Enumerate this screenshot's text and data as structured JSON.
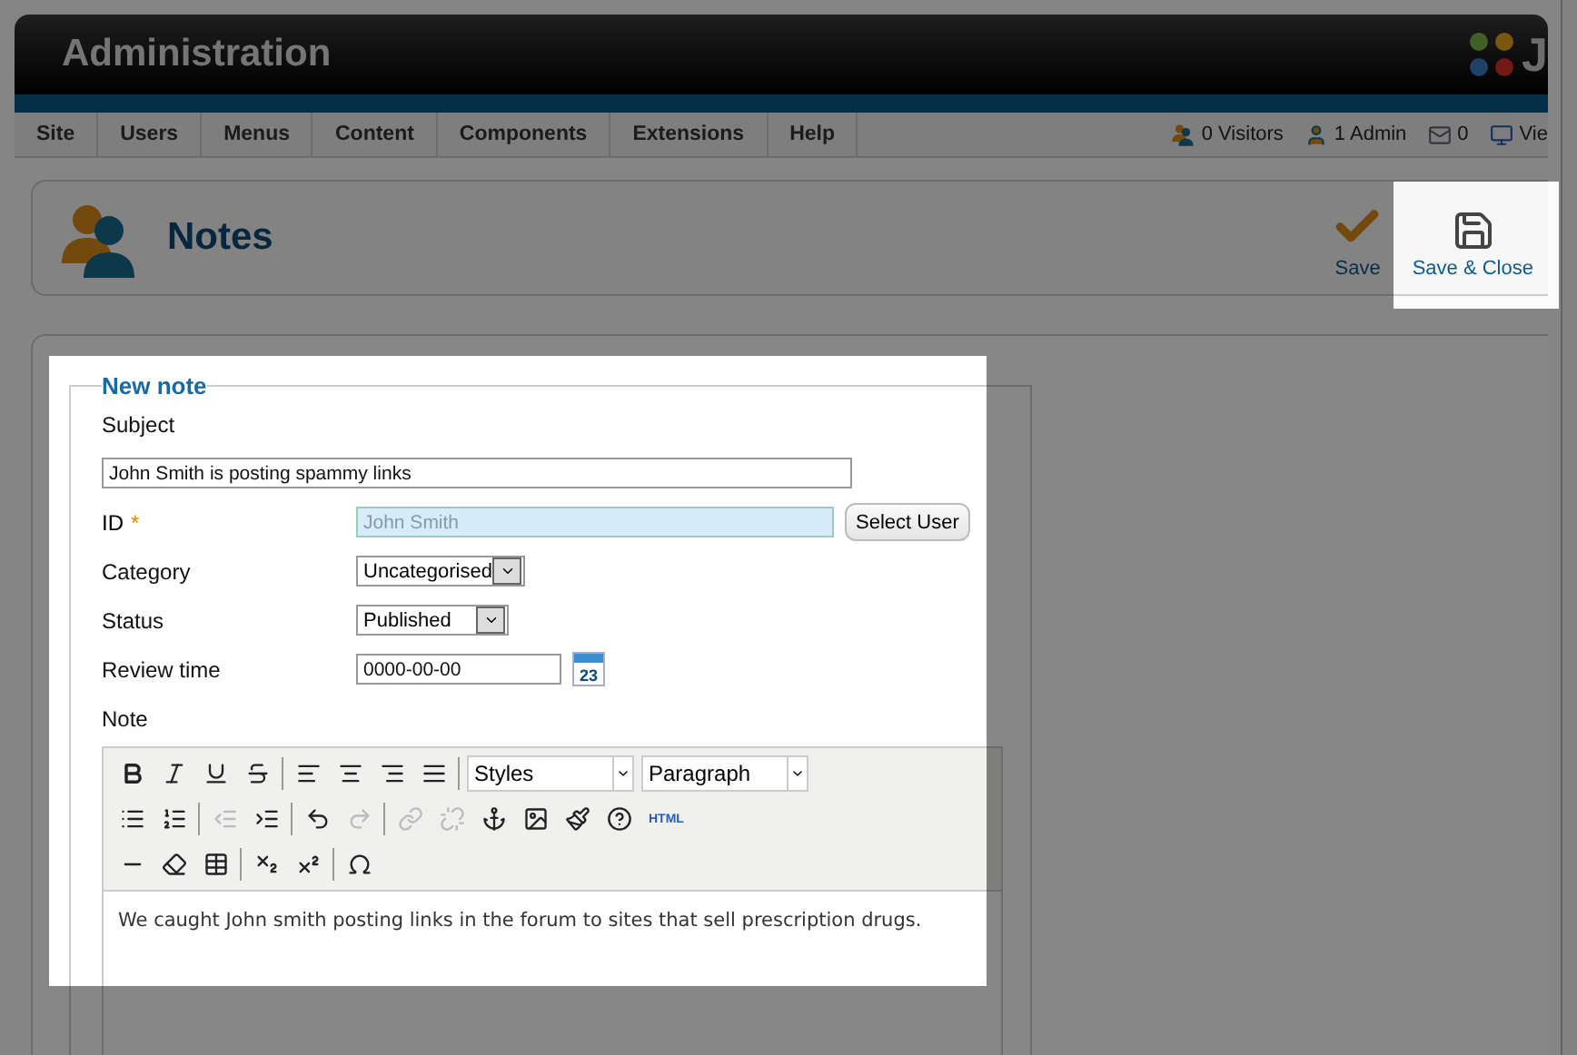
{
  "header": {
    "title": "Administration",
    "logo_text": "J"
  },
  "menu": [
    "Site",
    "Users",
    "Menus",
    "Content",
    "Components",
    "Extensions",
    "Help"
  ],
  "status": [
    {
      "kind": "visitors",
      "text": "0 Visitors"
    },
    {
      "kind": "admin",
      "text": "1 Admin"
    },
    {
      "kind": "messages",
      "text": "0"
    },
    {
      "kind": "view",
      "text": "Vie"
    }
  ],
  "toolbar": {
    "title": "Notes",
    "buttons": [
      {
        "kind": "save",
        "label": "Save"
      },
      {
        "kind": "save-close",
        "label": "Save & Close"
      }
    ]
  },
  "form": {
    "legend": "New note",
    "subject": {
      "label": "Subject",
      "value": "John Smith is posting spammy links"
    },
    "id": {
      "label": "ID",
      "required_mark": "*",
      "value": "John Smith",
      "button": "Select User"
    },
    "category": {
      "label": "Category",
      "value": "Uncategorised"
    },
    "status": {
      "label": "Status",
      "value": "Published"
    },
    "review": {
      "label": "Review time",
      "value": "0000-00-00",
      "calendar": "23"
    },
    "note": {
      "label": "Note",
      "text": "We caught John smith posting links in the forum to sites that sell prescription drugs."
    }
  },
  "editor": {
    "rows": [
      [
        {
          "kind": "bold",
          "disabled": false
        },
        {
          "kind": "italic",
          "disabled": false
        },
        {
          "kind": "underline",
          "disabled": false
        },
        {
          "kind": "strike",
          "disabled": false
        },
        {
          "kind": "sep"
        },
        {
          "kind": "align-left",
          "disabled": false
        },
        {
          "kind": "align-center",
          "disabled": false
        },
        {
          "kind": "align-right",
          "disabled": false
        },
        {
          "kind": "justify",
          "disabled": false
        },
        {
          "kind": "sep"
        },
        {
          "kind": "select",
          "value": "Styles"
        },
        {
          "kind": "select",
          "value": "Paragraph"
        }
      ],
      [
        {
          "kind": "bullets",
          "disabled": false
        },
        {
          "kind": "numbers",
          "disabled": false
        },
        {
          "kind": "sep"
        },
        {
          "kind": "outdent",
          "disabled": true
        },
        {
          "kind": "indent",
          "disabled": false
        },
        {
          "kind": "sep"
        },
        {
          "kind": "undo",
          "disabled": false
        },
        {
          "kind": "redo",
          "disabled": true
        },
        {
          "kind": "sep"
        },
        {
          "kind": "link",
          "disabled": true
        },
        {
          "kind": "unlink",
          "disabled": true
        },
        {
          "kind": "anchor",
          "disabled": false
        },
        {
          "kind": "image",
          "disabled": false
        },
        {
          "kind": "cleanup",
          "disabled": false
        },
        {
          "kind": "help",
          "disabled": false
        },
        {
          "kind": "html",
          "label": "HTML",
          "disabled": false
        }
      ],
      [
        {
          "kind": "rule",
          "disabled": false
        },
        {
          "kind": "eraser",
          "disabled": false
        },
        {
          "kind": "table",
          "disabled": false
        },
        {
          "kind": "sep"
        },
        {
          "kind": "subscript",
          "disabled": false
        },
        {
          "kind": "superscript",
          "disabled": false
        },
        {
          "kind": "sep"
        },
        {
          "kind": "omega",
          "disabled": false
        }
      ]
    ]
  }
}
